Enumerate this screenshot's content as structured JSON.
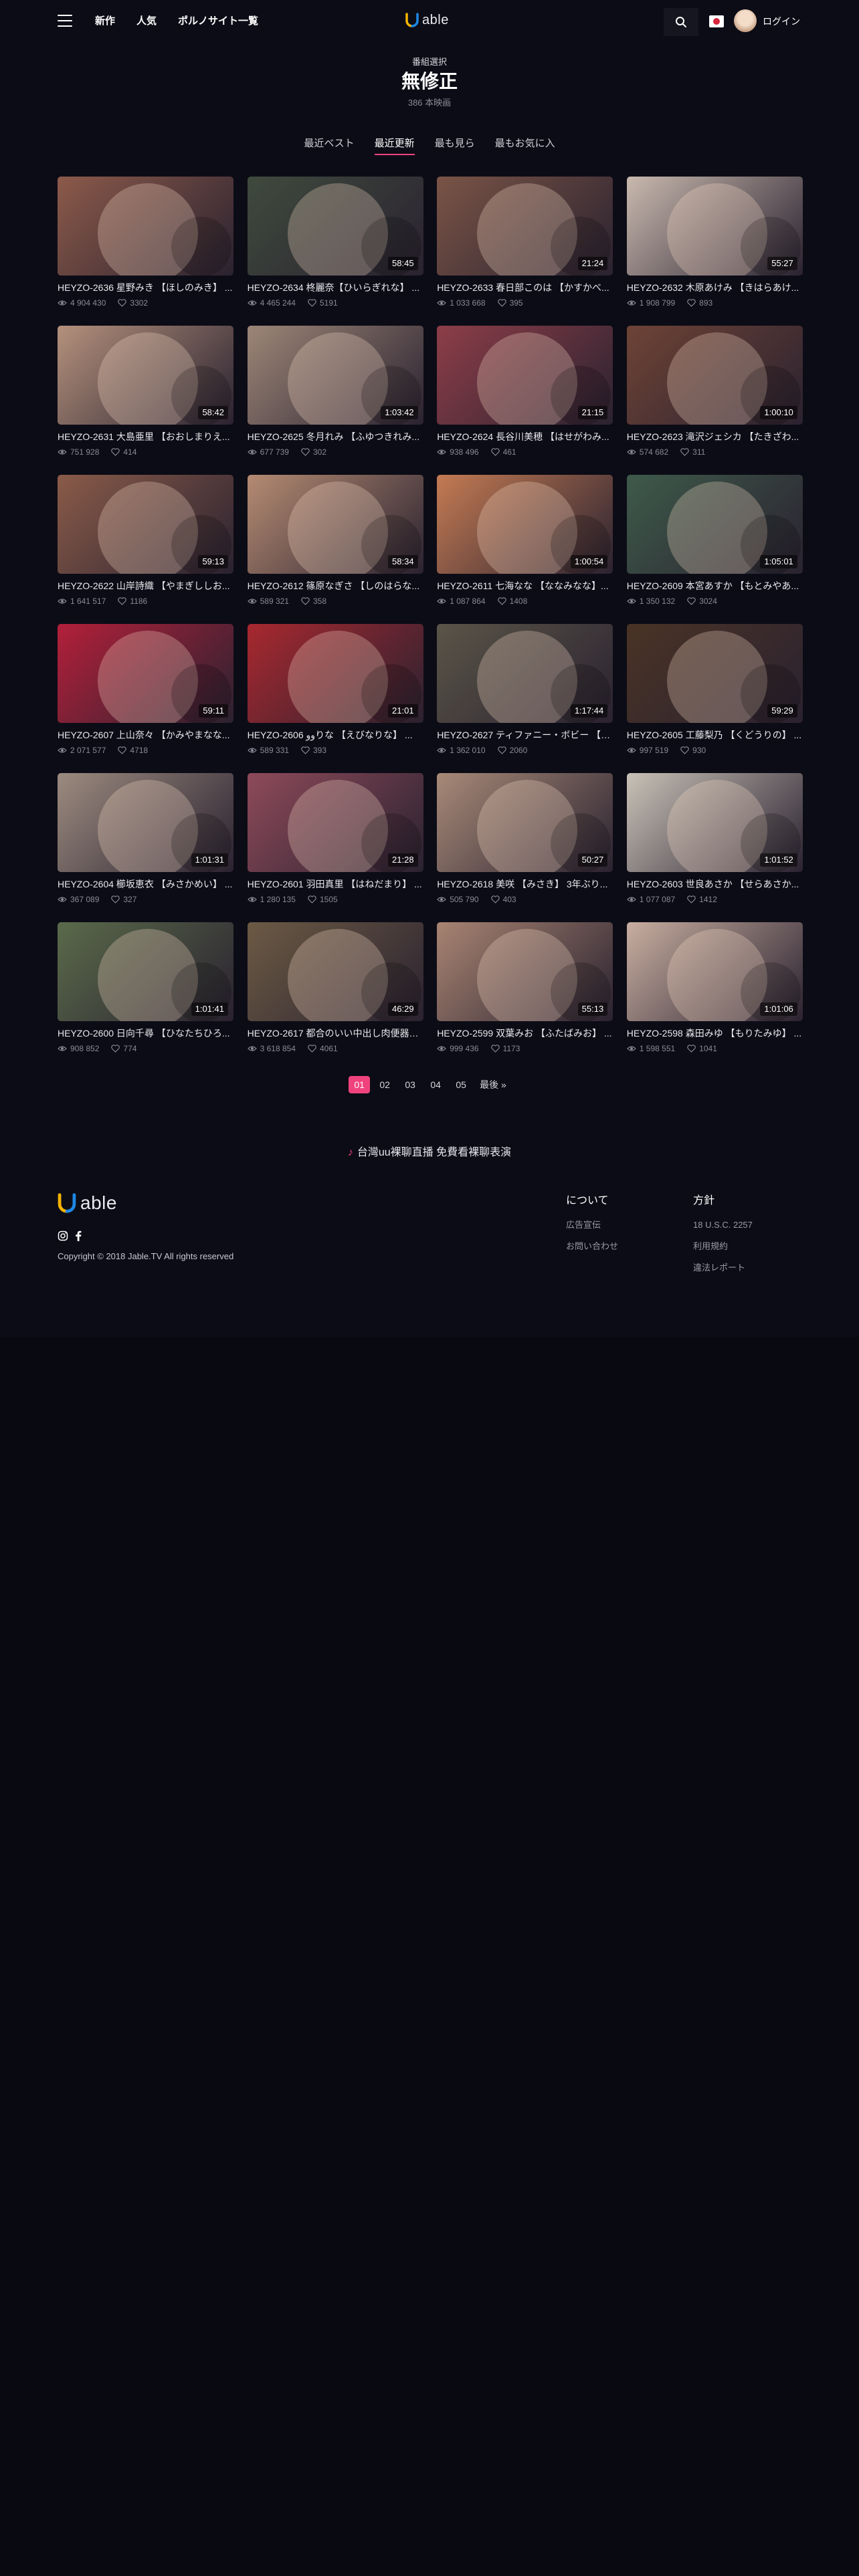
{
  "header": {
    "nav": [
      "新作",
      "人気",
      "ポルノサイト一覧"
    ],
    "logo_text": "able",
    "login_label": "ログイン",
    "colors": {
      "accent": "#f0437e",
      "logo_yellow": "#f5b400",
      "logo_blue": "#1e88e5"
    }
  },
  "page": {
    "subtitle": "番組選択",
    "title": "無修正",
    "count": "386 本映画"
  },
  "tabs": [
    {
      "label": "最近ベスト",
      "active": false
    },
    {
      "label": "最近更新",
      "active": true
    },
    {
      "label": "最も見ら",
      "active": false
    },
    {
      "label": "最もお気に入",
      "active": false
    }
  ],
  "videos": [
    {
      "title": "HEYZO-2636 星野みき 【ほしのみき】 ...",
      "duration": "",
      "views": "4 904 430",
      "likes": "3302",
      "color": "#8c5a4a"
    },
    {
      "title": "HEYZO-2634 柊麗奈【ひいらぎれな】 ...",
      "duration": "58:45",
      "views": "4 465 244",
      "likes": "5191",
      "color": "#3f4a3d"
    },
    {
      "title": "HEYZO-2633 春日部このは 【かすかべ...",
      "duration": "21:24",
      "views": "1 033 668",
      "likes": "395",
      "color": "#7a5446"
    },
    {
      "title": "HEYZO-2632 木原あけみ 【きはらあけ...",
      "duration": "55:27",
      "views": "1 908 799",
      "likes": "893",
      "color": "#c9b9ae"
    },
    {
      "title": "HEYZO-2631 大島亜里 【おおしまりえ...",
      "duration": "58:42",
      "views": "751 928",
      "likes": "414",
      "color": "#b4917c"
    },
    {
      "title": "HEYZO-2625 冬月れみ 【ふゆつきれみ...",
      "duration": "1:03:42",
      "views": "677 739",
      "likes": "302",
      "color": "#9d8677"
    },
    {
      "title": "HEYZO-2624 長谷川美穂 【はせがわみ...",
      "duration": "21:15",
      "views": "938 496",
      "likes": "461",
      "color": "#8d3e48"
    },
    {
      "title": "HEYZO-2623 滝沢ジェシカ 【たきざわ...",
      "duration": "1:00:10",
      "views": "574 682",
      "likes": "311",
      "color": "#6e4336"
    },
    {
      "title": "HEYZO-2622 山岸詩織 【やまぎししお...",
      "duration": "59:13",
      "views": "1 641 517",
      "likes": "1186",
      "color": "#8a5b49"
    },
    {
      "title": "HEYZO-2612 篠原なぎさ 【しのはらな...",
      "duration": "58:34",
      "views": "589 321",
      "likes": "358",
      "color": "#b58b72"
    },
    {
      "title": "HEYZO-2611 七海なな 【ななみなな】...",
      "duration": "1:00:54",
      "views": "1 087 864",
      "likes": "1408",
      "color": "#c47b53"
    },
    {
      "title": "HEYZO-2609 本宮あすか 【もとみやあ...",
      "duration": "1:05:01",
      "views": "1 350 132",
      "likes": "3024",
      "color": "#3e5a4a"
    },
    {
      "title": "HEYZO-2607 上山奈々 【かみやまなな...",
      "duration": "59:11",
      "views": "2 071 577",
      "likes": "4718",
      "color": "#b3203a"
    },
    {
      "title": "HEYZO-2606 ووりな 【えびなりな】 ...",
      "duration": "21:01",
      "views": "589 331",
      "likes": "393",
      "color": "#a8282f"
    },
    {
      "title": "HEYZO-2627 ティファニー・ボビー 【て...",
      "duration": "1:17:44",
      "views": "1 362 010",
      "likes": "2060",
      "color": "#5a5548"
    },
    {
      "title": "HEYZO-2605 工藤梨乃 【くどうりの】 ...",
      "duration": "59:29",
      "views": "997 519",
      "likes": "930",
      "color": "#4a3326"
    },
    {
      "title": "HEYZO-2604 櫛坂恵衣 【みさかめい】 ...",
      "duration": "1:01:31",
      "views": "367 089",
      "likes": "327",
      "color": "#9c8b7f"
    },
    {
      "title": "HEYZO-2601 羽田真里 【はねだまり】 ...",
      "duration": "21:28",
      "views": "1 280 135",
      "likes": "1505",
      "color": "#8e4a5a"
    },
    {
      "title": "HEYZO-2618 美咲 【みさき】 3年ぶり...",
      "duration": "50:27",
      "views": "505 790",
      "likes": "403",
      "color": "#a88a78"
    },
    {
      "title": "HEYZO-2603 世良あさか 【せらあさか...",
      "duration": "1:01:52",
      "views": "1 077 087",
      "likes": "1412",
      "color": "#c9c2b7"
    },
    {
      "title": "HEYZO-2600 日向千尋 【ひなたちひろ...",
      "duration": "1:01:41",
      "views": "908 852",
      "likes": "774",
      "color": "#5a6a4a"
    },
    {
      "title": "HEYZO-2617 都合のいい中出し肉便器を...",
      "duration": "46:29",
      "views": "3 618 854",
      "likes": "4061",
      "color": "#6c5a44"
    },
    {
      "title": "HEYZO-2599 双葉みお 【ふたばみお】 ...",
      "duration": "55:13",
      "views": "999 436",
      "likes": "1173",
      "color": "#a88472"
    },
    {
      "title": "HEYZO-2598 森田みゆ 【もりたみゆ】 ...",
      "duration": "1:01:06",
      "views": "1 598 551",
      "likes": "1041",
      "color": "#c8aea0"
    }
  ],
  "pagination": {
    "pages": [
      "01",
      "02",
      "03",
      "04",
      "05"
    ],
    "current": "01",
    "last_label": "最後 »"
  },
  "promo": {
    "text": "台灣uu裸聊直播 免費看裸聊表演"
  },
  "footer": {
    "copyright": "Copyright © 2018 Jable.TV All rights reserved",
    "about": {
      "heading": "について",
      "links": [
        "広告宣伝",
        "お問い合わせ"
      ]
    },
    "policy": {
      "heading": "方針",
      "links": [
        "18 U.S.C. 2257",
        "利用規約",
        "違法レポート"
      ]
    }
  }
}
